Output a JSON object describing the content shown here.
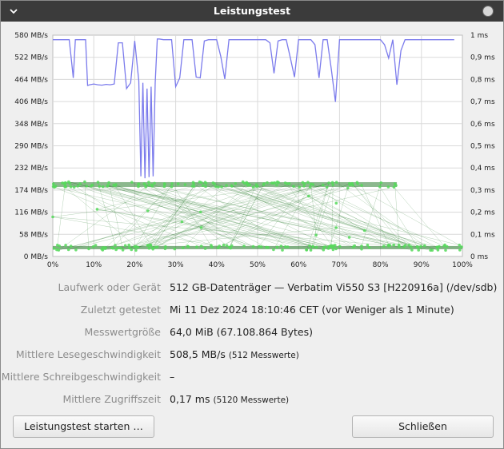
{
  "window": {
    "title": "Leistungstest"
  },
  "chart_data": {
    "type": "line",
    "y_left_ticks": [
      "580 MB/s",
      "522 MB/s",
      "464 MB/s",
      "406 MB/s",
      "348 MB/s",
      "290 MB/s",
      "232 MB/s",
      "174 MB/s",
      "116 MB/s",
      "58 MB/s",
      "0 MB/s"
    ],
    "y_right_ticks": [
      "1 ms",
      "0,9 ms",
      "0,8 ms",
      "0,7 ms",
      "0,6 ms",
      "0,5 ms",
      "0,4 ms",
      "0,3 ms",
      "0,2 ms",
      "0,1 ms",
      "0 ms"
    ],
    "x_ticks": [
      "0%",
      "10%",
      "20%",
      "30%",
      "40%",
      "50%",
      "60%",
      "70%",
      "80%",
      "90%",
      "100%"
    ],
    "read_speed_series": {
      "color": "#7b7bec",
      "x_percent": [
        0,
        1,
        2,
        3,
        4,
        4.5,
        5,
        5.5,
        8,
        8.5,
        9,
        10,
        11,
        12,
        13,
        14,
        15,
        16,
        17,
        18,
        19,
        20,
        21,
        21.5,
        22,
        22.5,
        23,
        23.5,
        24,
        24.5,
        25,
        25.5,
        26,
        27,
        28,
        29,
        30,
        31,
        32,
        33,
        34,
        34.5,
        35,
        36,
        37,
        38,
        39,
        40,
        41,
        42,
        43,
        44,
        45,
        46,
        47,
        48,
        49,
        50,
        51,
        52,
        53,
        54,
        55,
        56,
        57,
        58,
        59,
        60,
        61,
        62,
        63,
        64,
        65,
        66,
        67,
        68,
        69,
        70,
        71,
        72,
        73,
        74,
        75,
        76,
        77,
        78,
        79,
        80,
        81,
        82,
        83,
        84,
        85,
        86,
        87,
        88,
        89,
        90,
        91,
        92,
        93,
        94,
        95,
        96,
        97,
        98,
        99,
        100
      ],
      "mb_s": [
        568,
        568,
        568,
        568,
        568,
        520,
        468,
        568,
        568,
        448,
        450,
        452,
        450,
        449,
        451,
        450,
        452,
        560,
        560,
        440,
        455,
        565,
        460,
        210,
        455,
        205,
        440,
        208,
        445,
        210,
        455,
        570,
        570,
        568,
        568,
        568,
        445,
        468,
        568,
        568,
        568,
        520,
        470,
        468,
        565,
        568,
        568,
        568,
        525,
        465,
        568,
        568,
        568,
        568,
        568,
        568,
        568,
        568,
        568,
        568,
        560,
        480,
        565,
        568,
        568,
        520,
        470,
        568,
        568,
        568,
        568,
        555,
        468,
        568,
        568,
        490,
        405,
        568,
        568,
        568,
        568,
        568,
        568,
        568,
        568,
        568,
        568,
        568,
        555,
        520,
        568,
        450,
        540,
        568,
        568,
        568,
        568,
        568,
        568,
        568,
        568,
        568,
        568,
        568,
        568,
        568
      ]
    },
    "access_time_clusters_ms": [
      0.325,
      0.04
    ],
    "access_color": "#55d95a",
    "line_color": "#2e7d32"
  },
  "info": {
    "device_label": "Laufwerk oder Gerät",
    "device_value": "512 GB-Datenträger — Verbatim Vi550 S3 [H220916a] (/dev/sdb)",
    "last_tested_label": "Zuletzt getestet",
    "last_tested_value": "Mi 11 Dez 2024 18:10:46 CET (vor Weniger als 1 Minute)",
    "sample_size_label": "Messwertgröße",
    "sample_size_value": "64,0 MiB (67.108.864 Bytes)",
    "avg_read_label": "Mittlere Lesegeschwindigkeit",
    "avg_read_value": "508,5 MB/s",
    "avg_read_samples": "(512 Messwerte)",
    "avg_write_label": "Mittlere Schreibgeschwindigkeit",
    "avg_write_value": "–",
    "avg_access_label": "Mittlere Zugriffszeit",
    "avg_access_value": "0,17 ms",
    "avg_access_samples": "(5120 Messwerte)"
  },
  "buttons": {
    "start": "Leistungstest starten …",
    "close": "Schließen"
  }
}
